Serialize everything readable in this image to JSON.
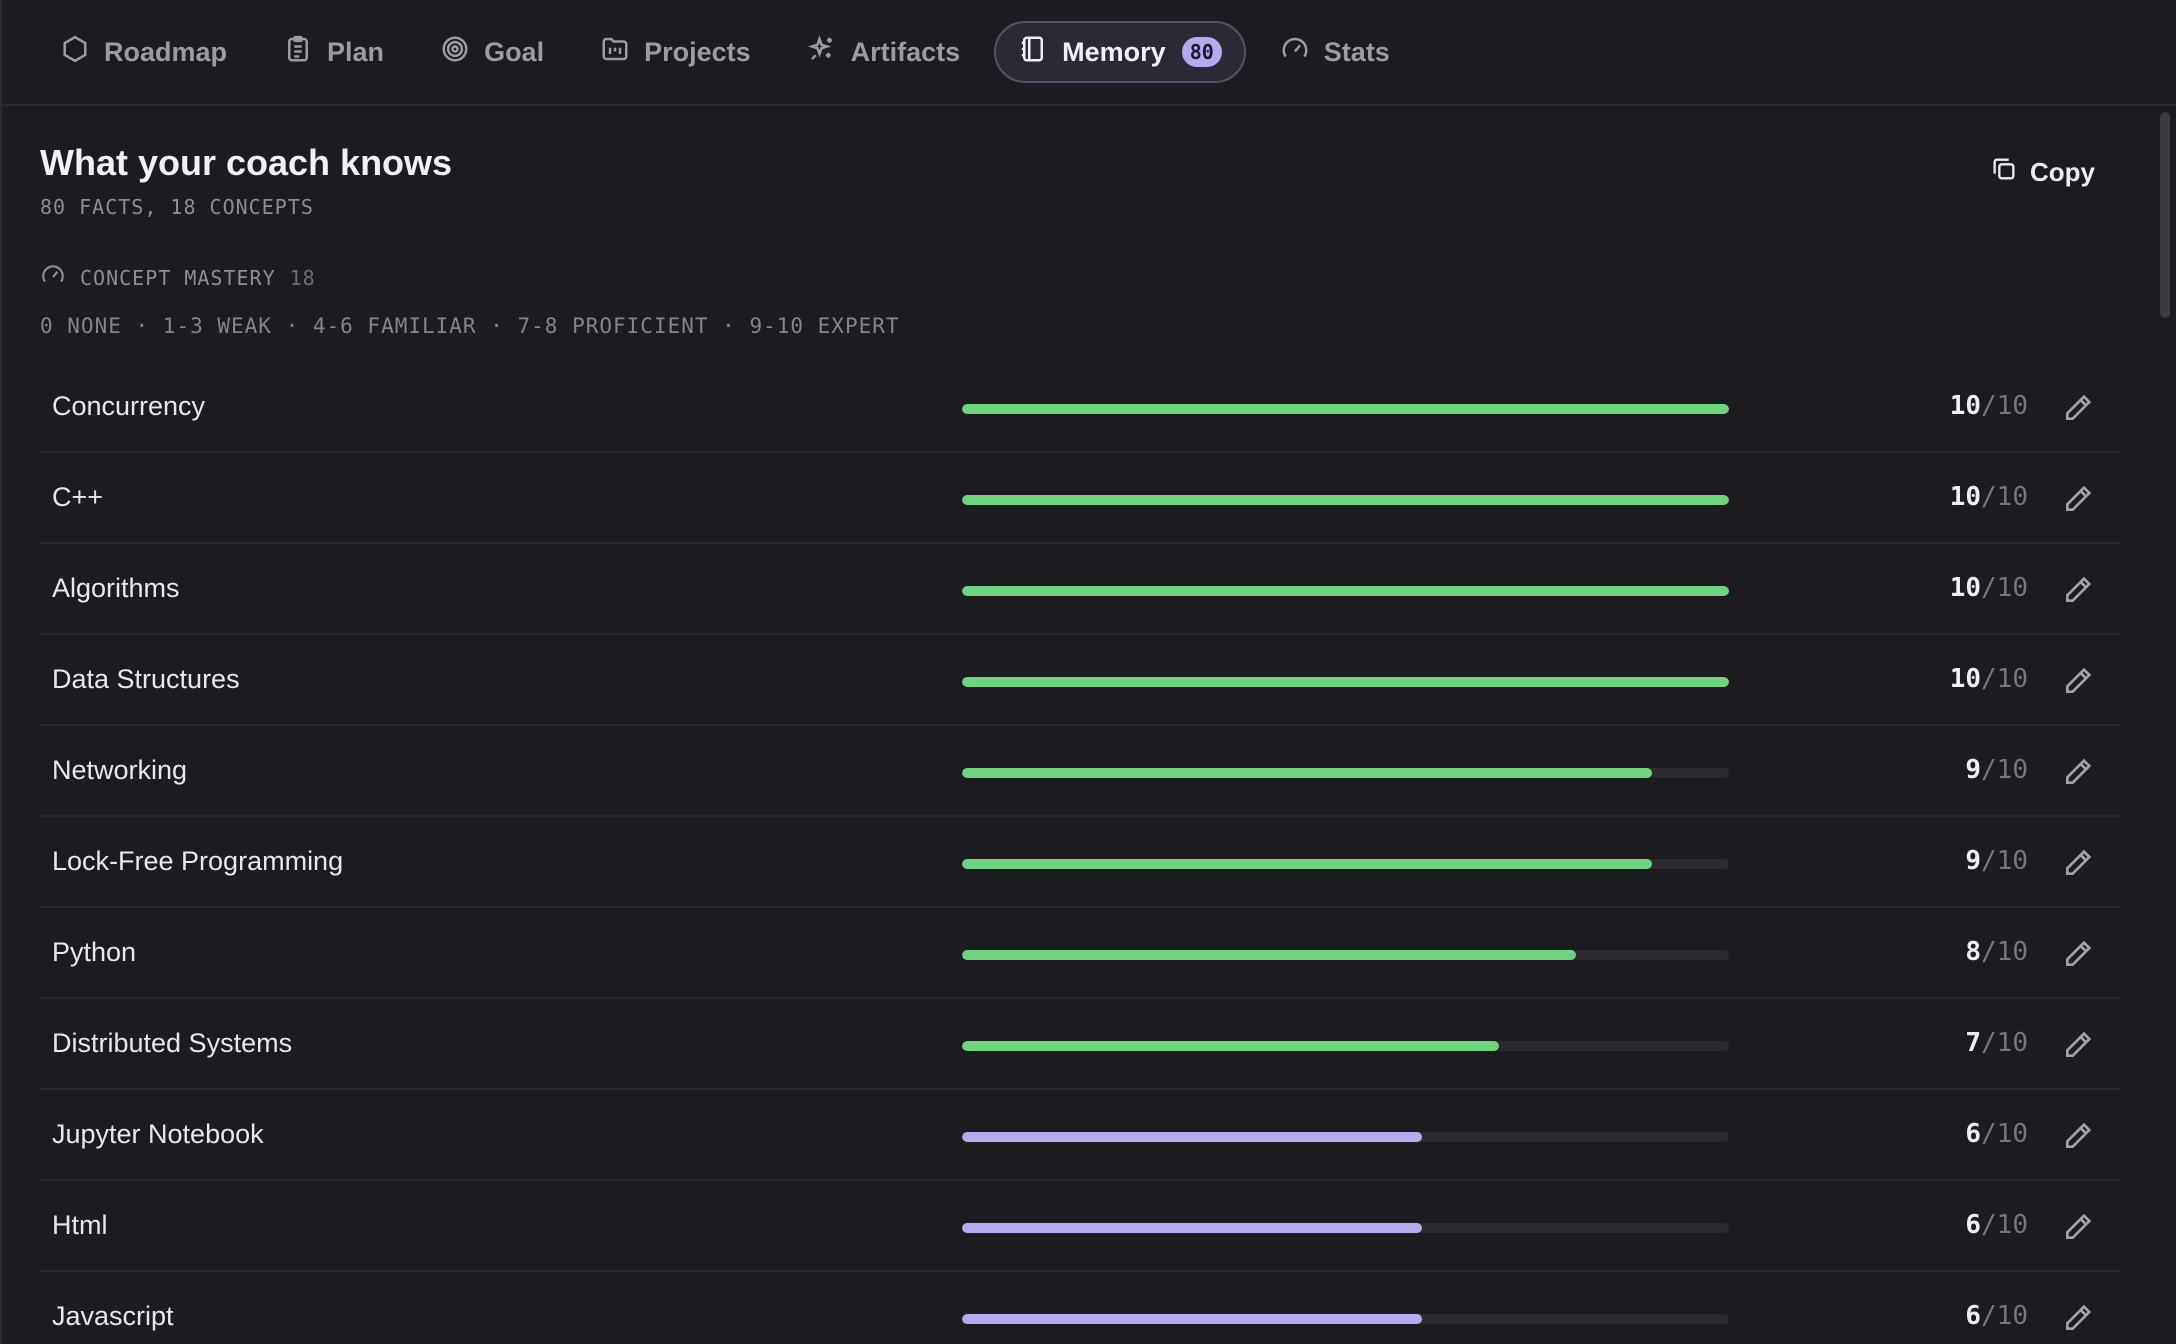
{
  "nav": {
    "tabs": [
      {
        "label": "Roadmap",
        "icon": "hexagon-icon"
      },
      {
        "label": "Plan",
        "icon": "clipboard-icon"
      },
      {
        "label": "Goal",
        "icon": "target-icon"
      },
      {
        "label": "Projects",
        "icon": "folder-icon"
      },
      {
        "label": "Artifacts",
        "icon": "sparkles-icon"
      },
      {
        "label": "Memory",
        "icon": "notebook-icon",
        "badge": "80",
        "active": true
      },
      {
        "label": "Stats",
        "icon": "gauge-icon"
      }
    ]
  },
  "header": {
    "title": "What your coach knows",
    "subtitle": "80 FACTS, 18 CONCEPTS",
    "copy_label": "Copy"
  },
  "section": {
    "title": "CONCEPT MASTERY",
    "count": "18",
    "legend": "0 NONE · 1-3 WEAK · 4-6 FAMILIAR · 7-8 PROFICIENT · 9-10 EXPERT"
  },
  "colors": {
    "expert_bar": "#6fd47e",
    "familiar_bar": "#b9a9ee",
    "accent": "#b7a8f0"
  },
  "concepts": [
    {
      "name": "Concurrency",
      "score": "10",
      "max": "/10",
      "level": 10
    },
    {
      "name": "C++",
      "score": "10",
      "max": "/10",
      "level": 10
    },
    {
      "name": "Algorithms",
      "score": "10",
      "max": "/10",
      "level": 10
    },
    {
      "name": "Data Structures",
      "score": "10",
      "max": "/10",
      "level": 10
    },
    {
      "name": "Networking",
      "score": "9",
      "max": "/10",
      "level": 9
    },
    {
      "name": "Lock-Free Programming",
      "score": "9",
      "max": "/10",
      "level": 9
    },
    {
      "name": "Python",
      "score": "8",
      "max": "/10",
      "level": 8
    },
    {
      "name": "Distributed Systems",
      "score": "7",
      "max": "/10",
      "level": 7
    },
    {
      "name": "Jupyter Notebook",
      "score": "6",
      "max": "/10",
      "level": 6
    },
    {
      "name": "Html",
      "score": "6",
      "max": "/10",
      "level": 6
    },
    {
      "name": "Javascript",
      "score": "6",
      "max": "/10",
      "level": 6
    }
  ]
}
